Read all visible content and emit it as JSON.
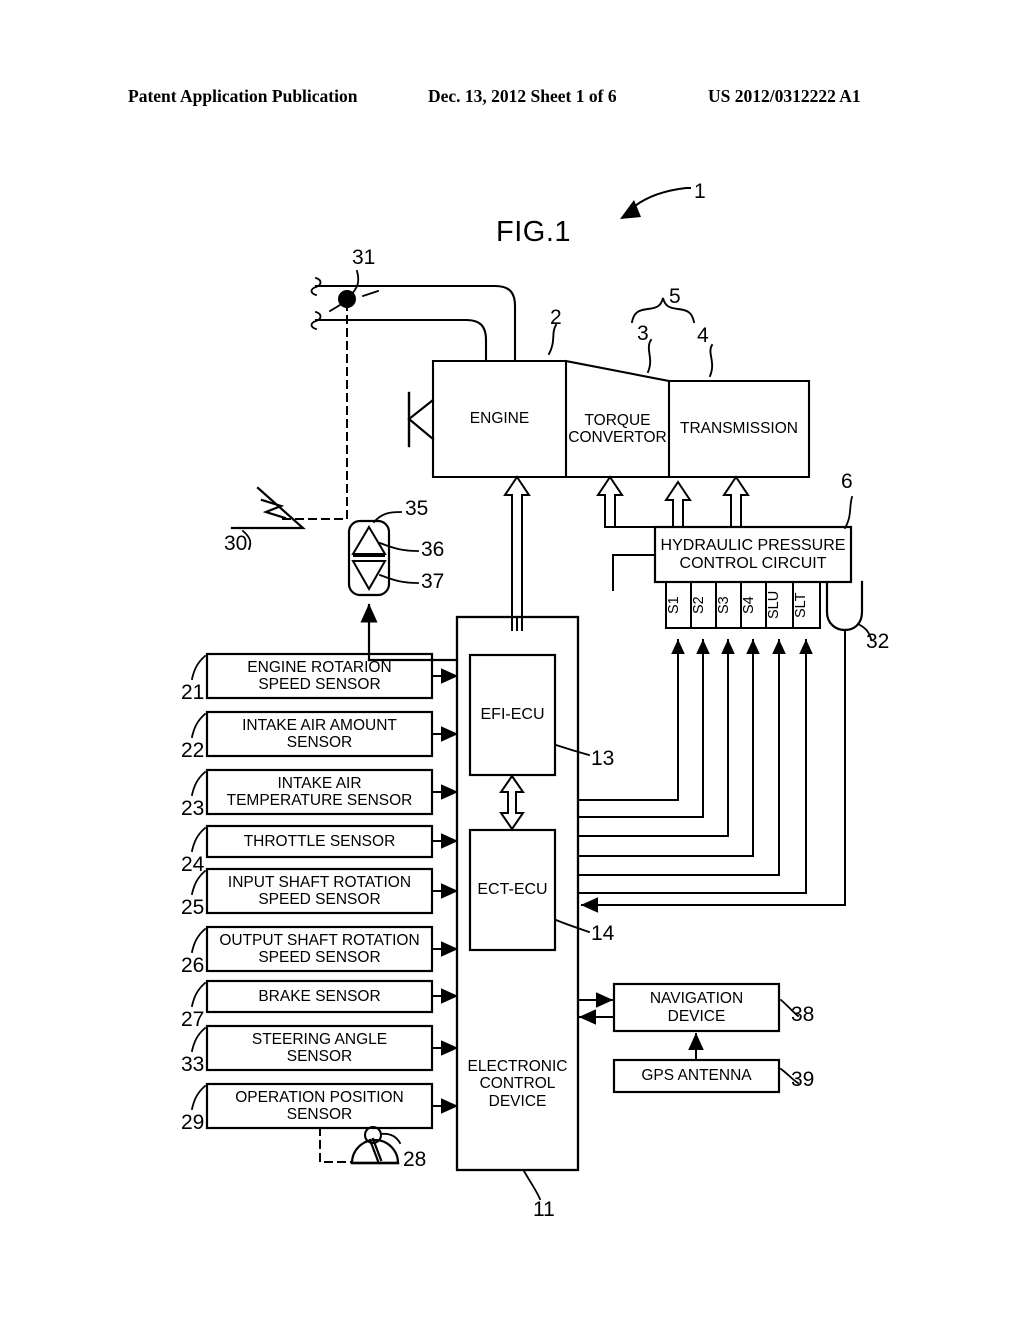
{
  "header": {
    "left": "Patent Application Publication",
    "middle": "Dec. 13, 2012  Sheet 1 of 6",
    "right": "US 2012/0312222 A1"
  },
  "figure": {
    "title": "FIG.1",
    "system_ref": "1"
  },
  "drivetrain": [
    {
      "label": "ENGINE",
      "ref": "2"
    },
    {
      "label": "TORQUE\nCONVERTOR",
      "ref": "3"
    },
    {
      "label": "TRANSMISSION",
      "ref": "4"
    }
  ],
  "brace_ref": "5",
  "hydraulic": {
    "label": "HYDRAULIC PRESSURE\nCONTROL CIRCUIT",
    "ref": "6"
  },
  "solenoids": {
    "items": [
      "S1",
      "S2",
      "S3",
      "S4",
      "SLU",
      "SLT"
    ],
    "oil_sensor_ref": "32"
  },
  "sensors": [
    {
      "ref": "21",
      "label": "ENGINE ROTARION\nSPEED SENSOR"
    },
    {
      "ref": "22",
      "label": "INTAKE AIR AMOUNT\nSENSOR"
    },
    {
      "ref": "23",
      "label": "INTAKE AIR\nTEMPERATURE SENSOR"
    },
    {
      "ref": "24",
      "label": "THROTTLE SENSOR"
    },
    {
      "ref": "25",
      "label": "INPUT SHAFT ROTATION\nSPEED SENSOR"
    },
    {
      "ref": "26",
      "label": "OUTPUT SHAFT ROTATION\nSPEED SENSOR"
    },
    {
      "ref": "27",
      "label": "BRAKE SENSOR"
    },
    {
      "ref": "33",
      "label": "STEERING ANGLE\nSENSOR"
    },
    {
      "ref": "29",
      "label": "OPERATION POSITION\nSENSOR"
    }
  ],
  "ecu": {
    "label": "ELECTRONIC\nCONTROL\nDEVICE",
    "ref": "11",
    "efi": {
      "label": "EFI-ECU",
      "ref": "13"
    },
    "ect": {
      "label": "ECT-ECU",
      "ref": "14"
    }
  },
  "navigation": {
    "label": "NAVIGATION\nDEVICE",
    "ref": "38"
  },
  "gps": {
    "label": "GPS ANTENNA",
    "ref": "39"
  },
  "misc": {
    "accel_pedal_ref": "31",
    "wheel_ref": "30",
    "paddle_ref": "35",
    "upshift_ref": "36",
    "downshift_ref": "37",
    "shift_lever_ref": "28"
  },
  "colors": {
    "ink": "#000000",
    "paper": "#ffffff"
  }
}
